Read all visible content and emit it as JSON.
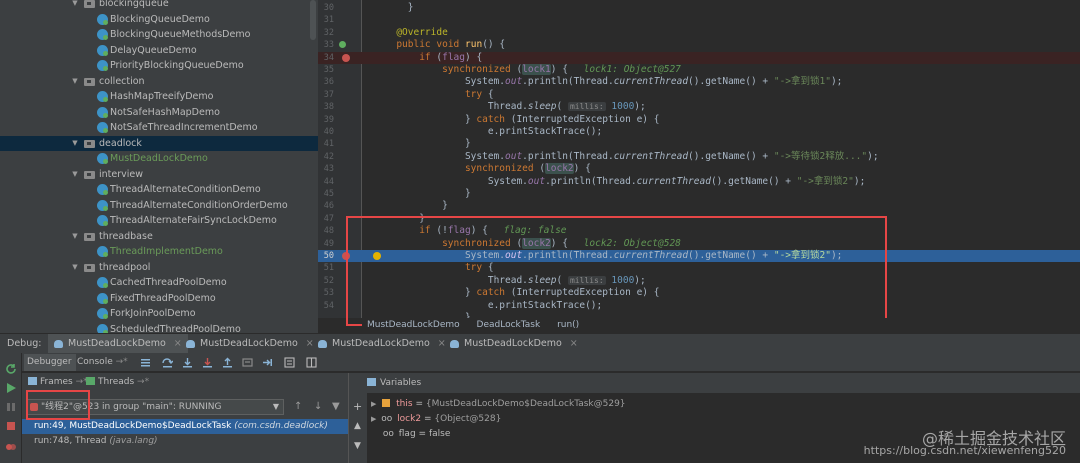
{
  "project_tree": {
    "items": [
      {
        "label": "blockingqueue",
        "type": "package",
        "indent": 1
      },
      {
        "label": "BlockingQueueDemo",
        "type": "class",
        "indent": 2
      },
      {
        "label": "BlockingQueueMethodsDemo",
        "type": "class",
        "indent": 2
      },
      {
        "label": "DelayQueueDemo",
        "type": "class",
        "indent": 2
      },
      {
        "label": "PriorityBlockingQueueDemo",
        "type": "class",
        "indent": 2
      },
      {
        "label": "collection",
        "type": "package",
        "indent": 1
      },
      {
        "label": "HashMapTreeifyDemo",
        "type": "class",
        "indent": 2
      },
      {
        "label": "NotSafeHashMapDemo",
        "type": "class",
        "indent": 2
      },
      {
        "label": "NotSafeThreadIncrementDemo",
        "type": "class",
        "indent": 2
      },
      {
        "label": "deadlock",
        "type": "package",
        "indent": 1
      },
      {
        "label": "MustDeadLockDemo",
        "type": "class",
        "indent": 2
      },
      {
        "label": "interview",
        "type": "package",
        "indent": 1
      },
      {
        "label": "ThreadAlternateConditionDemo",
        "type": "class",
        "indent": 2
      },
      {
        "label": "ThreadAlternateConditionOrderDemo",
        "type": "class",
        "indent": 2
      },
      {
        "label": "ThreadAlternateFairSyncLockDemo",
        "type": "class",
        "indent": 2
      },
      {
        "label": "threadbase",
        "type": "package",
        "indent": 1
      },
      {
        "label": "ThreadImplementDemo",
        "type": "class",
        "indent": 2
      },
      {
        "label": "threadpool",
        "type": "package",
        "indent": 1
      },
      {
        "label": "CachedThreadPoolDemo",
        "type": "class",
        "indent": 2
      },
      {
        "label": "FixedThreadPoolDemo",
        "type": "class",
        "indent": 2
      },
      {
        "label": "ForkJoinPoolDemo",
        "type": "class",
        "indent": 2
      },
      {
        "label": "ScheduledThreadPoolDemo",
        "type": "class",
        "indent": 2
      }
    ]
  },
  "editor": {
    "line_numbers": [
      "30",
      "31",
      "32",
      "33",
      "34",
      "35",
      "36",
      "37",
      "38",
      "39",
      "40",
      "41",
      "42",
      "43",
      "44",
      "45",
      "46",
      "47",
      "48",
      "49",
      "50",
      "51",
      "52",
      "53",
      "54"
    ],
    "annotation": "@Override",
    "kw_public": "public",
    "kw_void": "void",
    "method_name": "run",
    "kw_if": "if",
    "kw_synchronized": "synchronized",
    "kw_try": "try",
    "kw_catch": "catch",
    "var_flag": "flag",
    "var_lock1": "lock1",
    "var_lock2": "lock2",
    "inline_lock1": "lock1: Object@527",
    "inline_flag": "flag: false",
    "inline_lock2": "lock2: Object@528",
    "hint_millis": "millis:",
    "num_1000": "1000",
    "str_got_lock1": "\"->拿到锁1\"",
    "str_wait_lock2": "\"->等待锁2释放...\"",
    "str_got_lock2": "\"->拿到锁2\"",
    "t_system": "System.",
    "t_out": "out",
    "t_println": ".println(Thread.",
    "t_current": "currentThread",
    "t_getname": "().getName() + ",
    "t_end": ");",
    "t_thread": "Thread.",
    "t_sleep": "sleep",
    "t_interrupted": "(InterruptedException e) {",
    "t_stacktrace": "e.printStackTrace();"
  },
  "breadcrumb": [
    "MustDeadLockDemo",
    "DeadLockTask",
    "run()"
  ],
  "debug": {
    "label": "Debug:",
    "tabs": [
      "MustDeadLockDemo",
      "MustDeadLockDemo",
      "MustDeadLockDemo",
      "MustDeadLockDemo"
    ],
    "subtabs": {
      "debugger": "Debugger",
      "console": "Console"
    },
    "frames_tab": "Frames",
    "threads_tab": "Threads",
    "thread_selector": "\"线程2\"@523 in group \"main\": RUNNING",
    "frames": [
      {
        "method": "run:49, MustDeadLockDemo$DeadLockTask",
        "package": "(com.csdn.deadlock)"
      },
      {
        "method": "run:748, Thread",
        "package": "(java.lang)"
      }
    ],
    "variables_title": "Variables",
    "variables": [
      {
        "name": "this",
        "value": "{MustDeadLockDemo$DeadLockTask@529}"
      },
      {
        "name": "lock2",
        "value": "{Object@528}"
      },
      {
        "name": "flag",
        "value": "false"
      }
    ]
  },
  "watermark": {
    "site": "@稀土掘金技术社区",
    "url": "https://blog.csdn.net/xiewenfeng520"
  },
  "colors": {
    "breakpoint": "#c75450",
    "current_line": "#2d6099",
    "annotation_box": "#e64646"
  }
}
